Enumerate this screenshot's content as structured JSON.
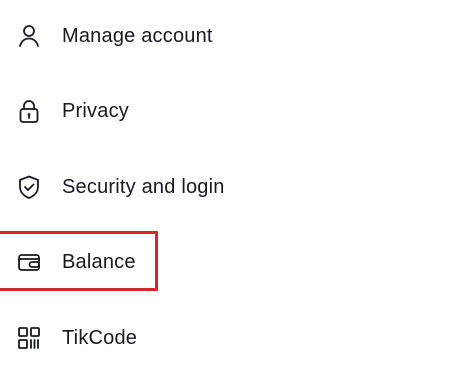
{
  "menu": {
    "items": [
      {
        "label": "Manage account",
        "icon": "person-icon"
      },
      {
        "label": "Privacy",
        "icon": "lock-icon"
      },
      {
        "label": "Security and login",
        "icon": "shield-check-icon"
      },
      {
        "label": "Balance",
        "icon": "wallet-icon"
      },
      {
        "label": "TikCode",
        "icon": "qr-code-icon"
      }
    ]
  },
  "colors": {
    "text": "#161823",
    "icon_stroke": "#161823",
    "highlight_border": "#d62828",
    "background": "#ffffff"
  },
  "annotation": {
    "highlighted_item": "Balance"
  }
}
